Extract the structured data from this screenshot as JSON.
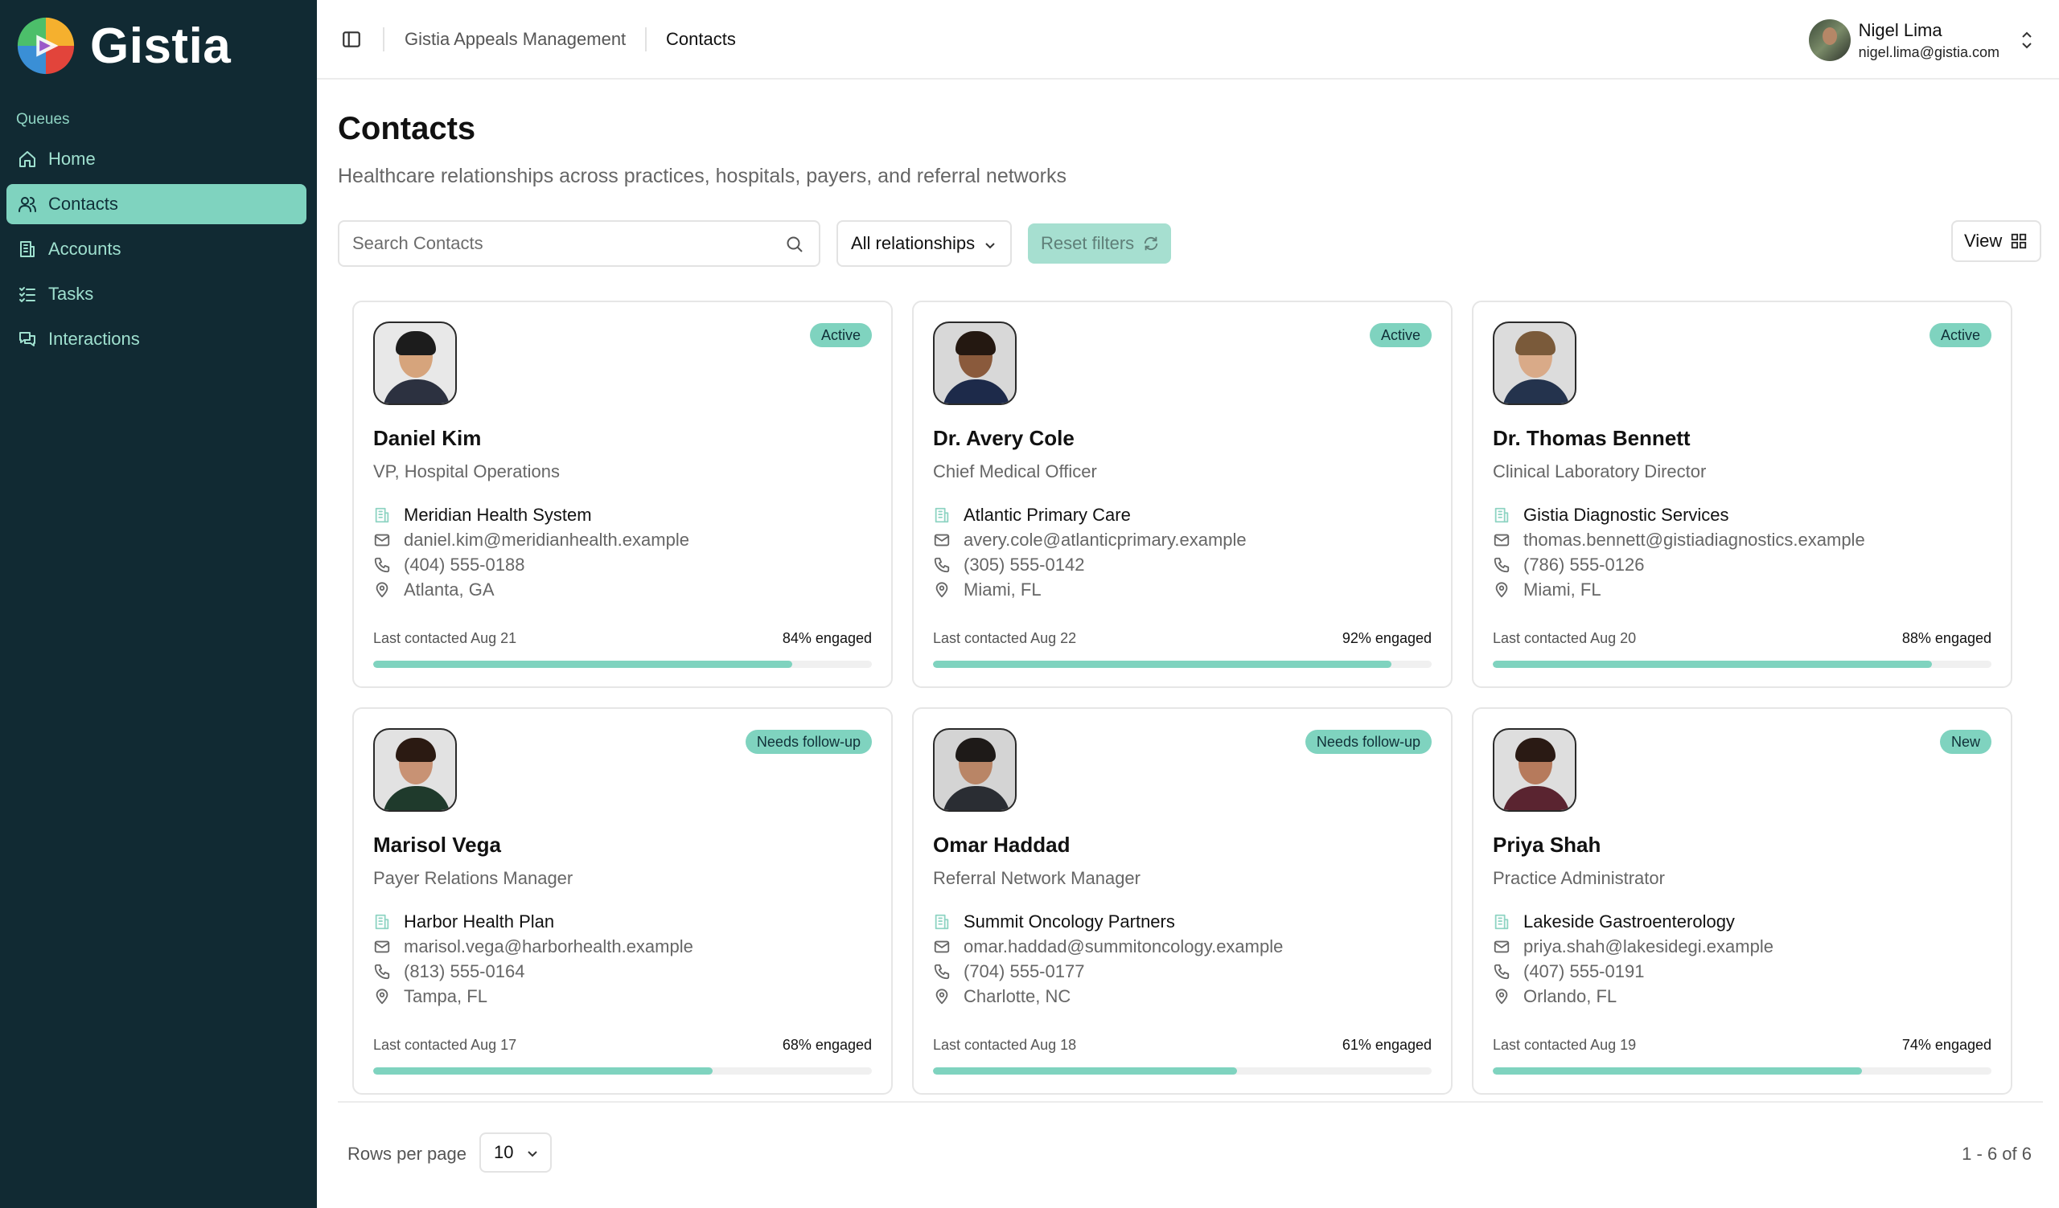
{
  "app": {
    "brand": "Gistia"
  },
  "sidebar": {
    "section_label": "Queues",
    "items": [
      {
        "label": "Home",
        "icon": "home-icon",
        "active": false
      },
      {
        "label": "Contacts",
        "icon": "users-icon",
        "active": true
      },
      {
        "label": "Accounts",
        "icon": "building-icon",
        "active": false
      },
      {
        "label": "Tasks",
        "icon": "checklist-icon",
        "active": false
      },
      {
        "label": "Interactions",
        "icon": "chat-icon",
        "active": false
      }
    ]
  },
  "topbar": {
    "breadcrumb_root": "Gistia Appeals Management",
    "breadcrumb_current": "Contacts",
    "user_name": "Nigel Lima",
    "user_email": "nigel.lima@gistia.com"
  },
  "page": {
    "title": "Contacts",
    "subtitle": "Healthcare relationships across practices, hospitals, payers, and referral networks"
  },
  "filters": {
    "search_placeholder": "Search Contacts",
    "relationship_value": "All relationships",
    "reset_label": "Reset filters",
    "view_label": "View"
  },
  "contacts": [
    {
      "name": "Daniel Kim",
      "role": "VP, Hospital Operations",
      "org": "Meridian Health System",
      "email": "daniel.kim@meridianhealth.example",
      "phone": "(404) 555-0188",
      "location": "Atlanta, GA",
      "status": "Active",
      "last_contacted": "Last contacted Aug 21",
      "engaged_label": "84% engaged",
      "engaged": 84
    },
    {
      "name": "Dr. Avery Cole",
      "role": "Chief Medical Officer",
      "org": "Atlantic Primary Care",
      "email": "avery.cole@atlanticprimary.example",
      "phone": "(305) 555-0142",
      "location": "Miami, FL",
      "status": "Active",
      "last_contacted": "Last contacted Aug 22",
      "engaged_label": "92% engaged",
      "engaged": 92
    },
    {
      "name": "Dr. Thomas Bennett",
      "role": "Clinical Laboratory Director",
      "org": "Gistia Diagnostic Services",
      "email": "thomas.bennett@gistiadiagnostics.example",
      "phone": "(786) 555-0126",
      "location": "Miami, FL",
      "status": "Active",
      "last_contacted": "Last contacted Aug 20",
      "engaged_label": "88% engaged",
      "engaged": 88
    },
    {
      "name": "Marisol Vega",
      "role": "Payer Relations Manager",
      "org": "Harbor Health Plan",
      "email": "marisol.vega@harborhealth.example",
      "phone": "(813) 555-0164",
      "location": "Tampa, FL",
      "status": "Needs follow-up",
      "last_contacted": "Last contacted Aug 17",
      "engaged_label": "68% engaged",
      "engaged": 68
    },
    {
      "name": "Omar Haddad",
      "role": "Referral Network Manager",
      "org": "Summit Oncology Partners",
      "email": "omar.haddad@summitoncology.example",
      "phone": "(704) 555-0177",
      "location": "Charlotte, NC",
      "status": "Needs follow-up",
      "last_contacted": "Last contacted Aug 18",
      "engaged_label": "61% engaged",
      "engaged": 61
    },
    {
      "name": "Priya Shah",
      "role": "Practice Administrator",
      "org": "Lakeside Gastroenterology",
      "email": "priya.shah@lakesidegi.example",
      "phone": "(407) 555-0191",
      "location": "Orlando, FL",
      "status": "New",
      "last_contacted": "Last contacted Aug 19",
      "engaged_label": "74% engaged",
      "engaged": 74
    }
  ],
  "pagination": {
    "rows_label": "Rows per page",
    "rows_value": "10",
    "range_text": "1 - 6 of 6"
  },
  "colors": {
    "sidebar_bg": "#112a33",
    "accent": "#7fd3bf",
    "accent_text": "#9fe0cf"
  }
}
